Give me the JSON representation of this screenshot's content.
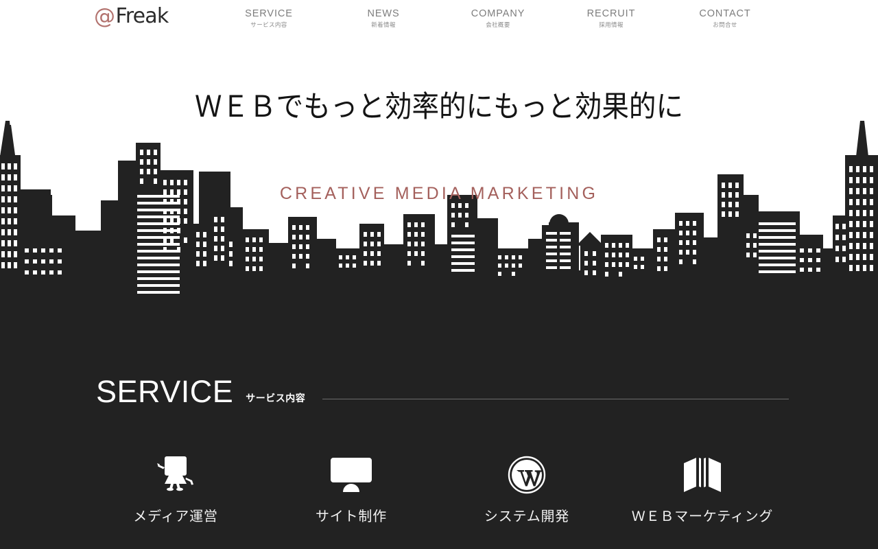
{
  "brand": {
    "at_symbol": "@",
    "name": "Freak",
    "at_color": "#b3736f",
    "name_color": "#2b2b2b"
  },
  "nav": {
    "items": [
      {
        "en": "SERVICE",
        "ja": "サービス内容"
      },
      {
        "en": "NEWS",
        "ja": "新着情報"
      },
      {
        "en": "COMPANY",
        "ja": "会社概要"
      },
      {
        "en": "RECRUIT",
        "ja": "採用情報"
      },
      {
        "en": "CONTACT",
        "ja": "お問合せ"
      }
    ]
  },
  "hero": {
    "title": "ＷＥＢでもっと効率的にもっと効果的に",
    "subtitle": "CREATIVE  MEDIA  MARKETING",
    "subtitle_color": "#a4605c",
    "background_color": "#ffffff",
    "skyline_color": "#222222"
  },
  "service_section": {
    "title": "SERVICE",
    "subtitle": "サービス内容",
    "background_color": "#222222",
    "rule_color": "#6d6d6d",
    "items": [
      {
        "icon": "mascot-character-icon",
        "label": "メディア運営"
      },
      {
        "icon": "imac-monitor-icon",
        "label": "サイト制作"
      },
      {
        "icon": "wordpress-logo-icon",
        "label": "システム開発"
      },
      {
        "icon": "folded-map-icon",
        "label": "ＷＥＢマーケティング"
      }
    ]
  }
}
